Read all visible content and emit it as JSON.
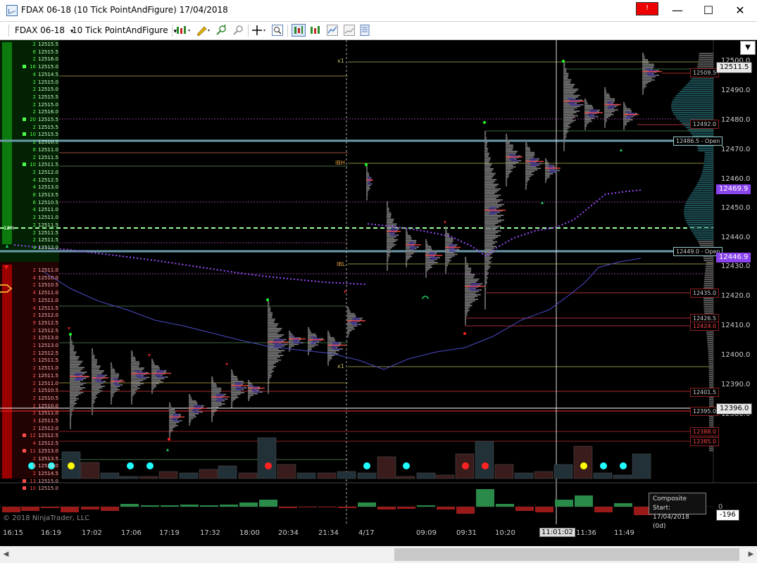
{
  "window": {
    "title": "FDAX 06-18 (10 Tick PointAndFigure)  17/04/2018",
    "alert_label": "!",
    "minimize": "—",
    "maximize": "☐",
    "close": "✕"
  },
  "toolbar": {
    "instrument": "FDAX 06-18",
    "instrument_arrow": "▾",
    "period": "10 Tick PointAndFigure",
    "period_arrow": "▾"
  },
  "price_axis": {
    "labels": [
      "12500.0",
      "12490.0",
      "12480.0",
      "12470.0",
      "12460.0",
      "12450.0",
      "12440.0",
      "12430.0",
      "12420.0",
      "12410.0",
      "12400.0",
      "12390.0",
      "12380.0"
    ],
    "current_price": "12511.5",
    "vwap_price": "12469.9",
    "low_price": "12446.9",
    "cursor_price": "12396.0",
    "bottom_value": "-196",
    "bottom_zero": "0"
  },
  "levels": [
    {
      "value": "12509.5",
      "color": "#ff5555"
    },
    {
      "value": "12492.0",
      "color": "#ff5555"
    },
    {
      "value": "12486.5 - Open",
      "color": "#9cc"
    },
    {
      "value": "12449.0 - Open",
      "color": "#9cc"
    },
    {
      "value": "12435.0",
      "color": "#ff5555"
    },
    {
      "value": "12426.5",
      "color": "#ff5555"
    },
    {
      "value": "12424.0",
      "color": "#ff3333"
    },
    {
      "value": "12401.5",
      "color": "#ff5555"
    },
    {
      "value": "12395.0",
      "color": "#ff5555"
    },
    {
      "value": "12388.0",
      "color": "#ff3333"
    },
    {
      "value": "12385.0",
      "color": "#ff3333"
    }
  ],
  "marker_labels": {
    "x1_top": "x1",
    "ibh": "IBH",
    "ibl": "IBL",
    "x1_bottom": "x1"
  },
  "composite": {
    "line1": "Composite Start:",
    "line2": "17/04/2018 (0d)"
  },
  "copyright": "© 2018 NinjaTrader, LLC",
  "time_axis": [
    "16:15",
    "16:19",
    "17:02",
    "17:06",
    "17:19",
    "17:32",
    "18:00",
    "20:34",
    "21:34",
    "4/17",
    "09:09",
    "09:31",
    "10:20",
    "11:36",
    "11:49"
  ],
  "time_cursor": "11:01:02",
  "ladder_percent": "12%",
  "ladder": {
    "green": [
      {
        "q": "2",
        "p": "12515.5"
      },
      {
        "q": "8",
        "p": "12515.5"
      },
      {
        "q": "2",
        "p": "12516.0"
      },
      {
        "q": "16",
        "p": "12515.0",
        "m": true
      },
      {
        "q": "4",
        "p": "12514.5"
      },
      {
        "q": "2",
        "p": "12515.0"
      },
      {
        "q": "2",
        "p": "12515.0"
      },
      {
        "q": "2",
        "p": "12515.5"
      },
      {
        "q": "2",
        "p": "12515.0"
      },
      {
        "q": "2",
        "p": "12516.0"
      },
      {
        "q": "20",
        "p": "12515.5",
        "m": true
      },
      {
        "q": "2",
        "p": "12515.5"
      },
      {
        "q": "10",
        "p": "12515.5",
        "m": true
      },
      {
        "q": "2",
        "p": "12510.5"
      },
      {
        "q": "8",
        "p": "12511.0"
      },
      {
        "q": "2",
        "p": "12511.5"
      },
      {
        "q": "10",
        "p": "12511.5",
        "m": true
      },
      {
        "q": "2",
        "p": "12512.0"
      },
      {
        "q": "4",
        "p": "12512.5"
      },
      {
        "q": "4",
        "p": "12513.0"
      },
      {
        "q": "8",
        "p": "12513.5"
      },
      {
        "q": "6",
        "p": "12510.5"
      },
      {
        "q": "4",
        "p": "12511.0"
      },
      {
        "q": "2",
        "p": "12511.0"
      },
      {
        "q": "2",
        "p": "12511.5"
      },
      {
        "q": "2",
        "p": "12511.5"
      },
      {
        "q": "2",
        "p": "12511.5"
      },
      {
        "q": "4",
        "p": "12512.0"
      }
    ],
    "red": [
      {
        "q": "2",
        "p": "12511.0"
      },
      {
        "q": "4",
        "p": "12510.0"
      },
      {
        "q": "2",
        "p": "12510.5"
      },
      {
        "q": "4",
        "p": "12511.0"
      },
      {
        "q": "5",
        "p": "12511.0"
      },
      {
        "q": "4",
        "p": "12511.5"
      },
      {
        "q": "2",
        "p": "12512.0"
      },
      {
        "q": "9",
        "p": "12512.5"
      },
      {
        "q": "2",
        "p": "12512.5"
      },
      {
        "q": "2",
        "p": "12513.0"
      },
      {
        "q": "2",
        "p": "12513.0"
      },
      {
        "q": "2",
        "p": "12512.5"
      },
      {
        "q": "5",
        "p": "12511.5"
      },
      {
        "q": "2",
        "p": "12511.0"
      },
      {
        "q": "2",
        "p": "12511.5"
      },
      {
        "q": "2",
        "p": "12511.0"
      },
      {
        "q": "2",
        "p": "12510.5"
      },
      {
        "q": "2",
        "p": "12510.5"
      },
      {
        "q": "2",
        "p": "12510.0"
      },
      {
        "q": "2",
        "p": "12511.0"
      },
      {
        "q": "3",
        "p": "12511.5"
      },
      {
        "q": "2",
        "p": "12512.0"
      },
      {
        "q": "12",
        "p": "12512.5",
        "m": true
      },
      {
        "q": "4",
        "p": "12512.5"
      },
      {
        "q": "11",
        "p": "12513.0",
        "m": true
      },
      {
        "q": "2",
        "p": "12513.5"
      },
      {
        "q": "6",
        "p": "12514.0"
      },
      {
        "q": "2",
        "p": "12514.5"
      },
      {
        "q": "13",
        "p": "12515.0",
        "m": true
      },
      {
        "q": "10",
        "p": "12515.0",
        "m": true
      }
    ]
  },
  "colors": {
    "green_ladder": "#0a6e0a",
    "red_ladder": "#8a0000",
    "vwap": "#9b4dff",
    "current_price_box": "#e8e8e8",
    "vwap_box": "#9b4dff"
  }
}
